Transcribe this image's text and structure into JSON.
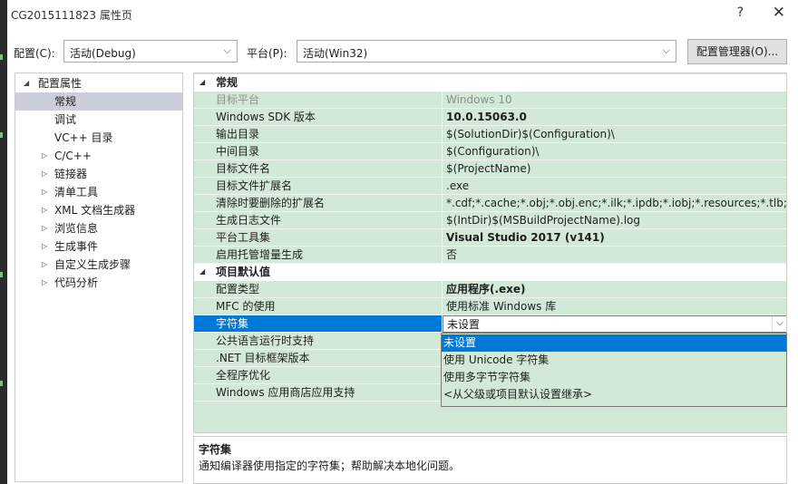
{
  "window": {
    "title": "CG2015111823 属性页",
    "help": "?",
    "close": "✕"
  },
  "config_bar": {
    "config_label": "配置(C):",
    "config_value": "活动(Debug)",
    "platform_label": "平台(P):",
    "platform_value": "活动(Win32)",
    "manager_button": "配置管理器(O)..."
  },
  "tree": {
    "root": "配置属性",
    "items": [
      "常规",
      "调试",
      "VC++ 目录",
      "C/C++",
      "链接器",
      "清单工具",
      "XML 文档生成器",
      "浏览信息",
      "生成事件",
      "自定义生成步骤",
      "代码分析"
    ]
  },
  "grid": {
    "cat1": "常规",
    "r0": {
      "name": "目标平台",
      "value": "Windows 10"
    },
    "r1": {
      "name": "Windows SDK 版本",
      "value": "10.0.15063.0"
    },
    "r2": {
      "name": "输出目录",
      "value": "$(SolutionDir)$(Configuration)\\"
    },
    "r3": {
      "name": "中间目录",
      "value": "$(Configuration)\\"
    },
    "r4": {
      "name": "目标文件名",
      "value": "$(ProjectName)"
    },
    "r5": {
      "name": "目标文件扩展名",
      "value": ".exe"
    },
    "r6": {
      "name": "清除时要删除的扩展名",
      "value": "*.cdf;*.cache;*.obj;*.obj.enc;*.ilk;*.ipdb;*.iobj;*.resources;*.tlb;*.tli;*.t"
    },
    "r7": {
      "name": "生成日志文件",
      "value": "$(IntDir)$(MSBuildProjectName).log"
    },
    "r8": {
      "name": "平台工具集",
      "value": "Visual Studio 2017 (v141)"
    },
    "r9": {
      "name": "启用托管增量生成",
      "value": "否"
    },
    "cat2": "项目默认值",
    "s0": {
      "name": "配置类型",
      "value": "应用程序(.exe)"
    },
    "s1": {
      "name": "MFC 的使用",
      "value": "使用标准 Windows 库"
    },
    "s2": {
      "name": "字符集",
      "value": "未设置"
    },
    "s3": {
      "name": "公共语言运行时支持",
      "value": ""
    },
    "s4": {
      "name": ".NET 目标框架版本",
      "value": ""
    },
    "s5": {
      "name": "全程序优化",
      "value": ""
    },
    "s6": {
      "name": "Windows 应用商店应用支持",
      "value": ""
    }
  },
  "dropdown": {
    "options": [
      "未设置",
      "使用 Unicode 字符集",
      "使用多字节字符集",
      "<从父级或项目默认设置继承>"
    ]
  },
  "description": {
    "title": "字符集",
    "text": "通知编译器使用指定的字符集；帮助解决本地化问题。"
  }
}
